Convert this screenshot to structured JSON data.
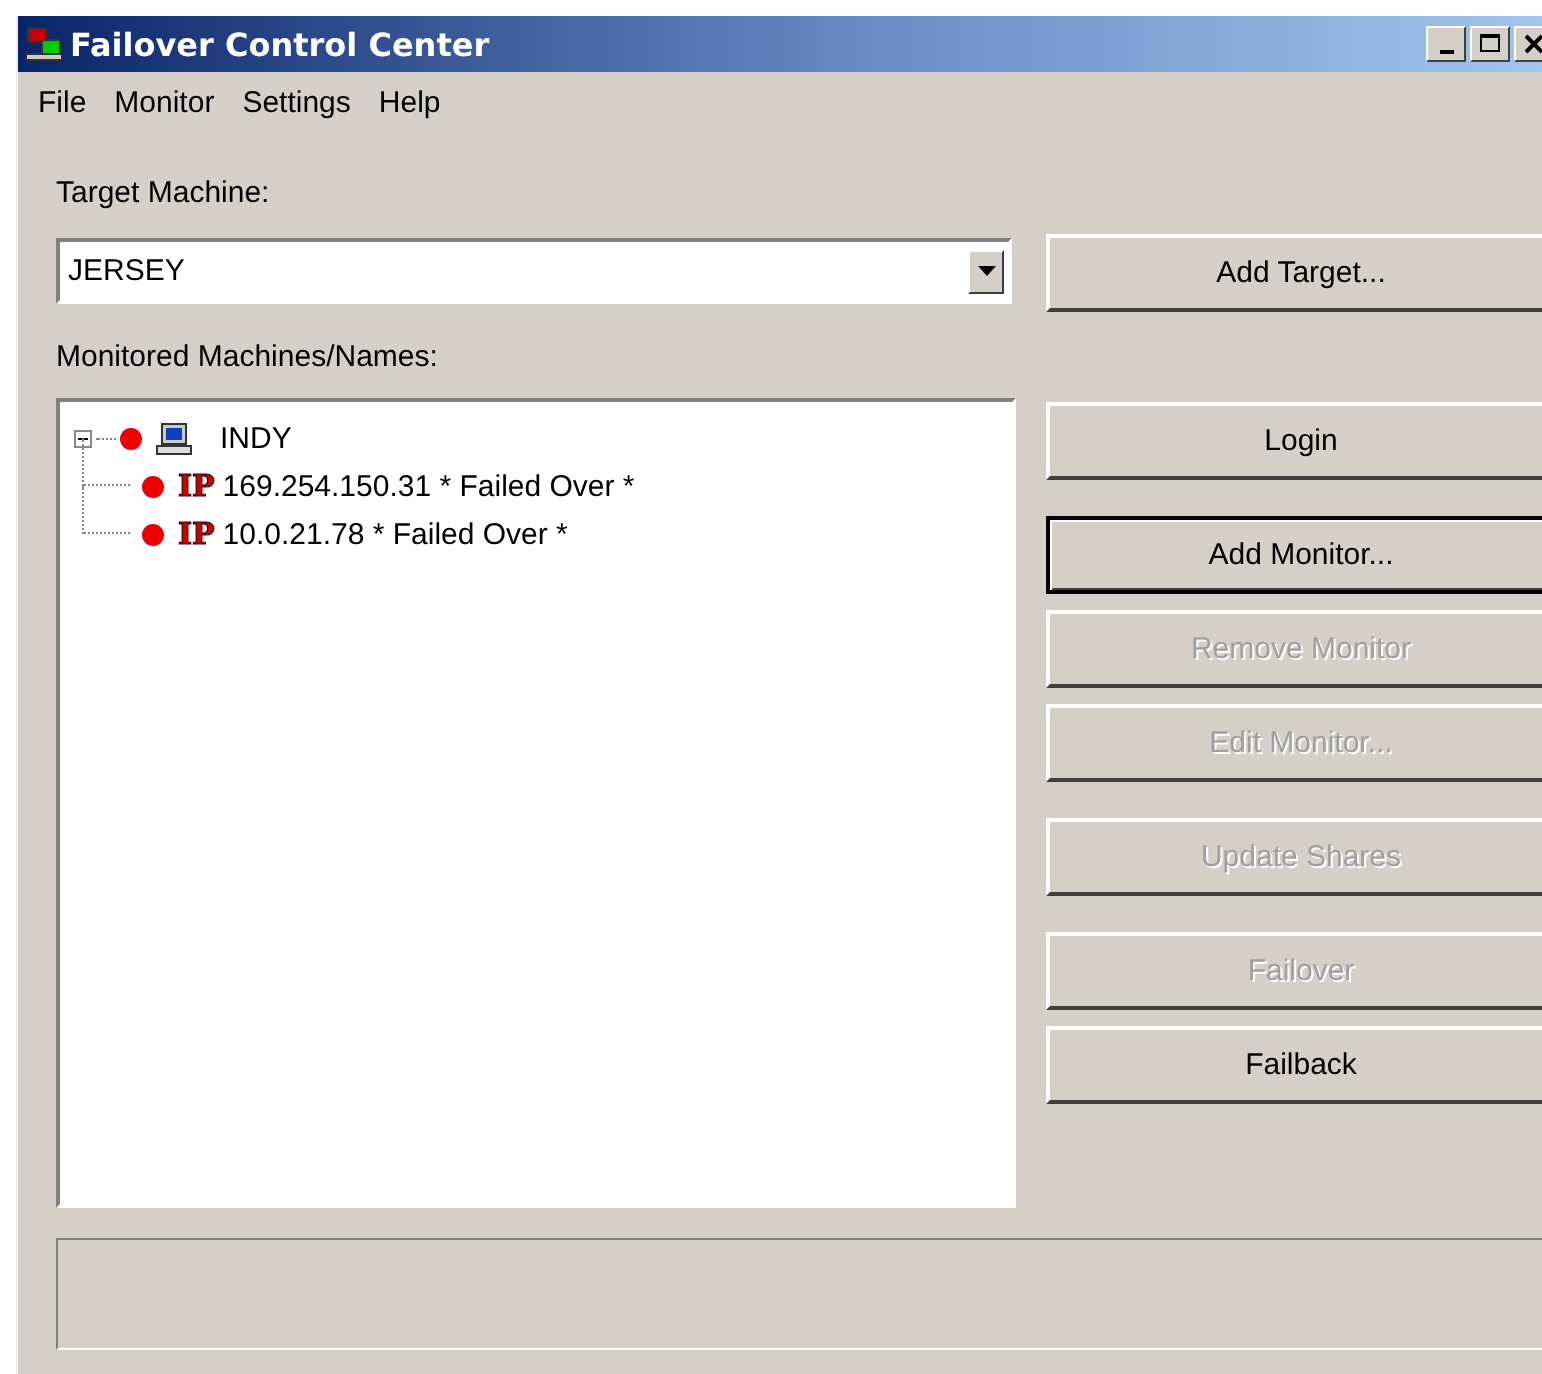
{
  "window": {
    "title": "Failover Control Center"
  },
  "menu": [
    "File",
    "Monitor",
    "Settings",
    "Help"
  ],
  "target": {
    "label": "Target Machine:",
    "value": "JERSEY",
    "button": "Add Target..."
  },
  "monitored": {
    "label": "Monitored Machines/Names:",
    "tree": [
      {
        "kind": "machine",
        "label": "INDY",
        "color": "#ee0000",
        "expanded": true,
        "children": [
          {
            "kind": "ip",
            "badge": "IP",
            "label": "169.254.150.31 * Failed Over *",
            "color": "#ee0000"
          },
          {
            "kind": "ip",
            "badge": "IP",
            "label": "10.0.21.78 * Failed Over *",
            "color": "#ee0000"
          }
        ]
      }
    ]
  },
  "button_groups": [
    [
      {
        "label": "Login",
        "disabled": false,
        "default": false
      }
    ],
    [
      {
        "label": "Add Monitor...",
        "disabled": false,
        "default": true
      },
      {
        "label": "Remove Monitor",
        "disabled": true,
        "default": false
      },
      {
        "label": "Edit Monitor...",
        "disabled": true,
        "default": false
      }
    ],
    [
      {
        "label": "Update Shares",
        "disabled": true,
        "default": false
      }
    ],
    [
      {
        "label": "Failover",
        "disabled": true,
        "default": false
      },
      {
        "label": "Failback",
        "disabled": false,
        "default": false
      }
    ]
  ]
}
